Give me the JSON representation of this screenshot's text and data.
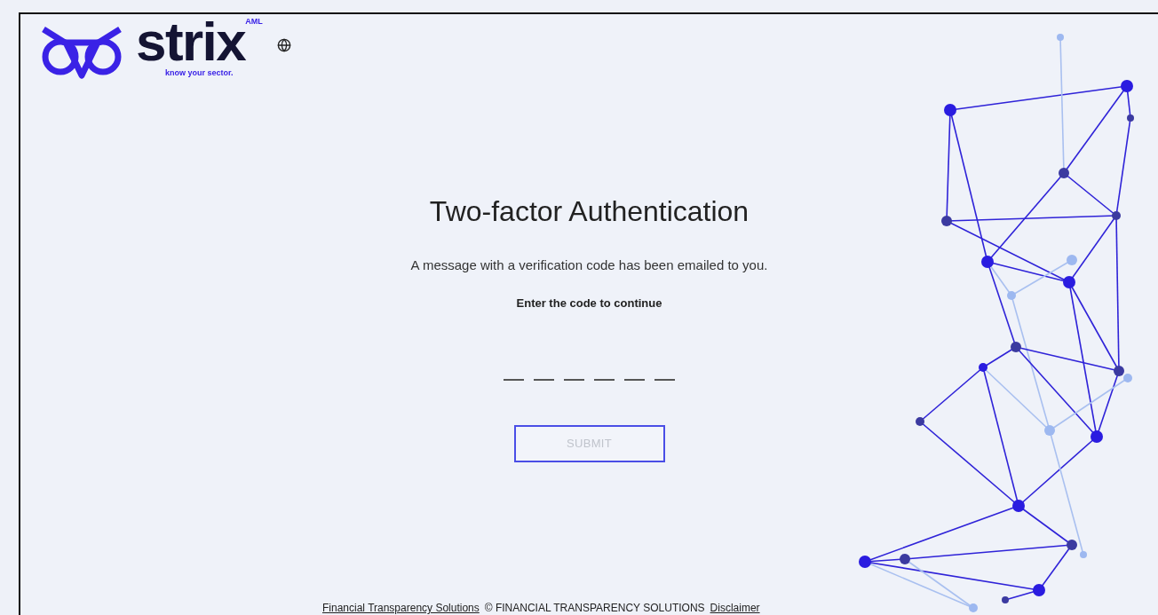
{
  "logo": {
    "wordmark": "strix",
    "badge": "AML",
    "tagline": "know your sector."
  },
  "title": "Two-factor Authentication",
  "message": "A message with a verification code has been emailed to you.",
  "instruction": "Enter the code to continue",
  "submit": {
    "label": "SUBMIT",
    "disabled": true
  },
  "footer": {
    "link": "Financial Transparency Solutions",
    "copyright": "© FINANCIAL TRANSPARENCY SOLUTIONS",
    "disclaimer": "Disclaimer"
  }
}
